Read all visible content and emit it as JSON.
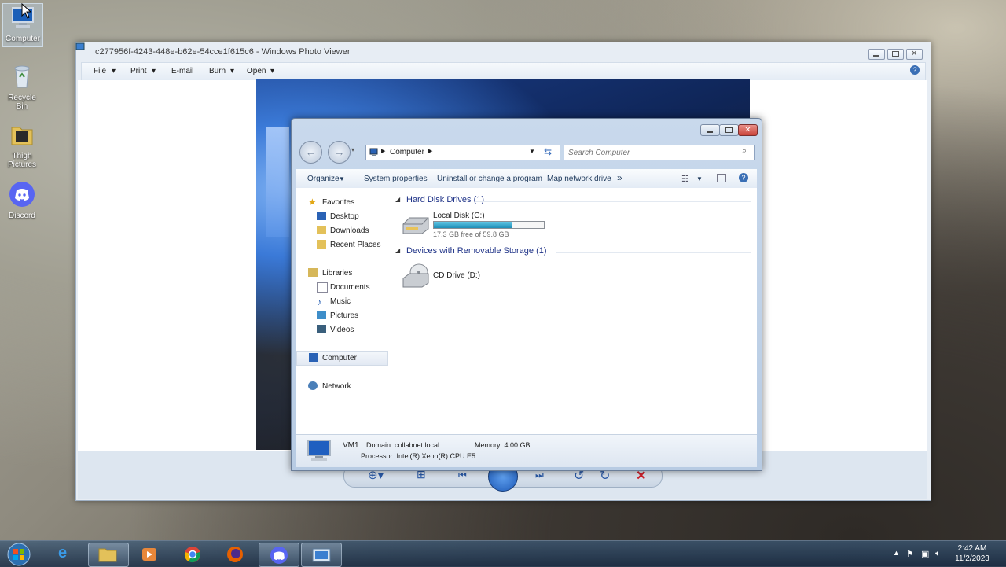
{
  "desktop": {
    "icons": [
      {
        "label": "Computer",
        "icon": "computer-icon"
      },
      {
        "label": "Recycle Bin",
        "icon": "recycle-bin-icon"
      },
      {
        "label": "Thigh Pictures",
        "line1": "Thigh",
        "line2": "Pictures",
        "icon": "folder-icon"
      },
      {
        "label": "Discord",
        "icon": "discord-icon"
      }
    ]
  },
  "photo_viewer": {
    "title": "c277956f-4243-448e-b62e-54cce1f615c6 - Windows Photo Viewer",
    "menu": {
      "file": "File",
      "print": "Print",
      "email": "E-mail",
      "burn": "Burn",
      "open": "Open"
    }
  },
  "explorer": {
    "address": "Computer",
    "search_placeholder": "Search Computer",
    "commands": {
      "organize": "Organize",
      "system_properties": "System properties",
      "uninstall": "Uninstall or change a program",
      "map_drive": "Map network drive",
      "more": "»"
    },
    "nav": {
      "favorites": "Favorites",
      "desktop": "Desktop",
      "downloads": "Downloads",
      "recent": "Recent Places",
      "libraries": "Libraries",
      "documents": "Documents",
      "music": "Music",
      "pictures": "Pictures",
      "videos": "Videos",
      "computer": "Computer",
      "network": "Network"
    },
    "groups": {
      "hdd_title": "Hard Disk Drives (1)",
      "removable_title": "Devices with Removable Storage (1)"
    },
    "drives": {
      "local_name": "Local Disk (C:)",
      "local_free": "17.3 GB free of 59.8 GB",
      "local_used_fraction": 0.71,
      "cd_name": "CD Drive (D:)"
    },
    "status": {
      "name": "VM1",
      "domain": "Domain: collabnet.local",
      "memory": "Memory: 4.00 GB",
      "processor": "Processor: Intel(R) Xeon(R) CPU E5..."
    }
  },
  "taskbar": {
    "time": "2:42 AM",
    "date": "11/2/2023",
    "apps": [
      "start-orb",
      "internet-explorer",
      "windows-explorer",
      "media-player",
      "chrome",
      "firefox",
      "discord",
      "photo-viewer"
    ]
  },
  "colors": {
    "accent": "#1e3287",
    "disk_bar": "#2aa3c9"
  }
}
